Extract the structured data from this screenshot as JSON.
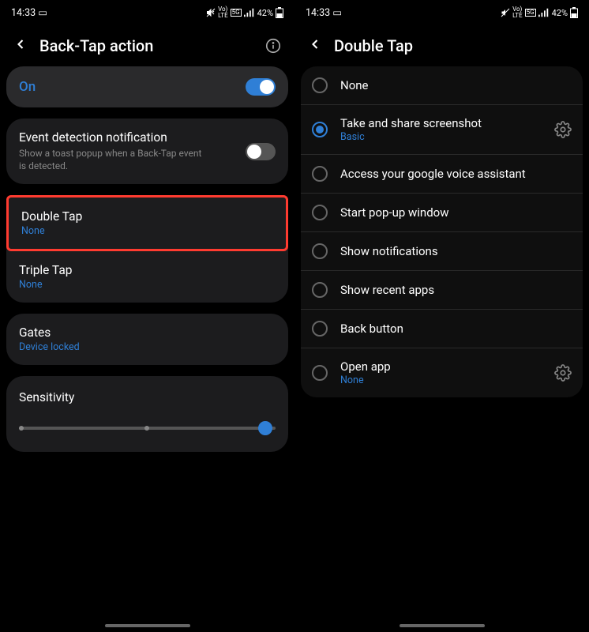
{
  "left": {
    "status": {
      "time": "14:33",
      "battery": "42%"
    },
    "header": {
      "title": "Back-Tap action"
    },
    "onCard": {
      "label": "On",
      "toggle": true
    },
    "eventCard": {
      "title": "Event detection notification",
      "desc": "Show a toast popup when a Back-Tap event is detected.",
      "toggle": false
    },
    "tapsCard": {
      "doubleTap": {
        "title": "Double Tap",
        "sub": "None"
      },
      "tripleTap": {
        "title": "Triple Tap",
        "sub": "None"
      }
    },
    "gatesCard": {
      "title": "Gates",
      "sub": "Device locked"
    },
    "sensitivityCard": {
      "title": "Sensitivity"
    }
  },
  "right": {
    "status": {
      "time": "14:33",
      "battery": "42%"
    },
    "header": {
      "title": "Double Tap"
    },
    "options": {
      "none": {
        "label": "None"
      },
      "screenshot": {
        "label": "Take and share screenshot",
        "sub": "Basic"
      },
      "voice": {
        "label": "Access your google voice assistant"
      },
      "popup": {
        "label": "Start pop-up window"
      },
      "notifications": {
        "label": "Show notifications"
      },
      "recent": {
        "label": "Show recent apps"
      },
      "back": {
        "label": "Back button"
      },
      "openApp": {
        "label": "Open app",
        "sub": "None"
      }
    }
  }
}
